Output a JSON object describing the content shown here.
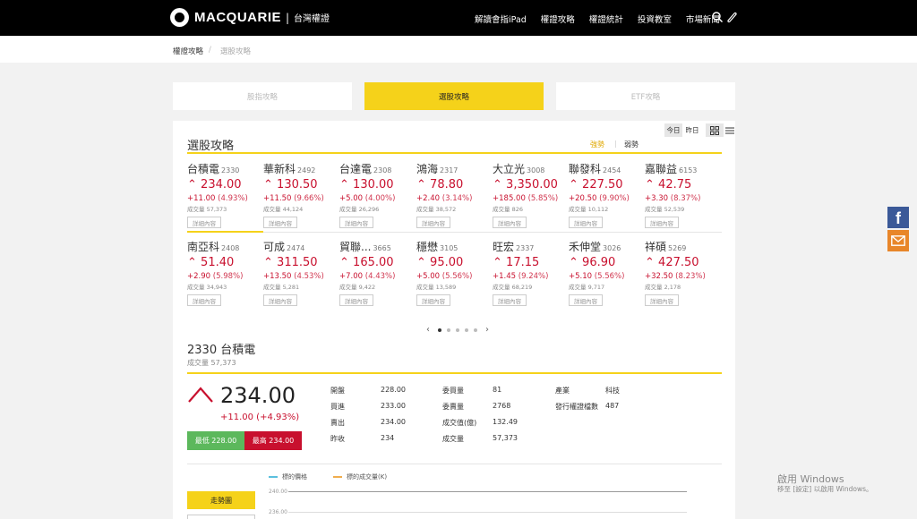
{
  "brand": {
    "name": "MACQUARIE",
    "sub": "台灣權證"
  },
  "nav": [
    "解讀會指iPad",
    "權證攻略",
    "權證統計",
    "投資教室",
    "市場新聞"
  ],
  "breadcrumb": {
    "root": "權證攻略",
    "sep": "/",
    "current": "選股攻略"
  },
  "tabs": [
    "股指攻略",
    "選股攻略",
    "ETF攻略"
  ],
  "view": {
    "today": "今日",
    "yesterday": "昨日"
  },
  "section": {
    "title": "選股攻略",
    "strong": "強勢",
    "weak": "弱勢"
  },
  "stock_detail_label": "詳細內容",
  "stocks": [
    {
      "name": "台積電",
      "code": "2330",
      "price": "234.00",
      "chg": "+11.00",
      "pct": "(4.93%)",
      "vol": "成交量 57,373"
    },
    {
      "name": "華新科",
      "code": "2492",
      "price": "130.50",
      "chg": "+11.50",
      "pct": "(9.66%)",
      "vol": "成交量 44,124"
    },
    {
      "name": "台達電",
      "code": "2308",
      "price": "130.00",
      "chg": "+5.00",
      "pct": "(4.00%)",
      "vol": "成交量 26,296"
    },
    {
      "name": "鴻海",
      "code": "2317",
      "price": "78.80",
      "chg": "+2.40",
      "pct": "(3.14%)",
      "vol": "成交量 38,572"
    },
    {
      "name": "大立光",
      "code": "3008",
      "price": "3,350.00",
      "chg": "+185.00",
      "pct": "(5.85%)",
      "vol": "成交量 826"
    },
    {
      "name": "聯發科",
      "code": "2454",
      "price": "227.50",
      "chg": "+20.50",
      "pct": "(9.90%)",
      "vol": "成交量 10,112"
    },
    {
      "name": "嘉聯益",
      "code": "6153",
      "price": "42.75",
      "chg": "+3.30",
      "pct": "(8.37%)",
      "vol": "成交量 52,539"
    },
    {
      "name": "南亞科",
      "code": "2408",
      "price": "51.40",
      "chg": "+2.90",
      "pct": "(5.98%)",
      "vol": "成交量 34,943"
    },
    {
      "name": "可成",
      "code": "2474",
      "price": "311.50",
      "chg": "+13.50",
      "pct": "(4.53%)",
      "vol": "成交量 5,281"
    },
    {
      "name": "貿聯...",
      "code": "3665",
      "price": "165.00",
      "chg": "+7.00",
      "pct": "(4.43%)",
      "vol": "成交量 9,422"
    },
    {
      "name": "穩懋",
      "code": "3105",
      "price": "95.00",
      "chg": "+5.00",
      "pct": "(5.56%)",
      "vol": "成交量 13,589"
    },
    {
      "name": "旺宏",
      "code": "2337",
      "price": "17.15",
      "chg": "+1.45",
      "pct": "(9.24%)",
      "vol": "成交量 68,219"
    },
    {
      "name": "禾伸堂",
      "code": "3026",
      "price": "96.90",
      "chg": "+5.10",
      "pct": "(5.56%)",
      "vol": "成交量 9,717"
    },
    {
      "name": "祥碩",
      "code": "5269",
      "price": "427.50",
      "chg": "+32.50",
      "pct": "(8.23%)",
      "vol": "成交量 2,178"
    }
  ],
  "pager": {
    "pages": 5,
    "current": 1
  },
  "detail": {
    "title": "2330 台積電",
    "volume": "成交量 57,373",
    "price": "234.00",
    "change": "+11.00 (+4.93%)",
    "low": "最低 228.00",
    "high": "最高 234.00",
    "col1": [
      {
        "k": "開盤",
        "v": "228.00"
      },
      {
        "k": "買進",
        "v": "233.00"
      },
      {
        "k": "賣出",
        "v": "234.00"
      },
      {
        "k": "昨收",
        "v": "234"
      }
    ],
    "col2": [
      {
        "k": "委買量",
        "v": "81"
      },
      {
        "k": "委賣量",
        "v": "2768"
      },
      {
        "k": "成交值(億)",
        "v": "132.49"
      },
      {
        "k": "成交量",
        "v": "57,373"
      }
    ],
    "col3": [
      {
        "k": "產業",
        "v": "科技"
      },
      {
        "k": "發行權證檔數",
        "v": "487"
      }
    ]
  },
  "chart": {
    "legend_price": "標的價格",
    "legend_volume": "標的成交量(K)",
    "y_ticks": [
      "240.00",
      "236.00"
    ],
    "colors": {
      "price": "#5bc0de",
      "volume": "#f0ad4e"
    },
    "button": "走勢圖"
  },
  "watermark": {
    "line1": "啟用 Windows",
    "line2": "移至 [設定] 以啟用 Windows。"
  },
  "colors": {
    "accent": "#f5d21a",
    "up": "#c8102e",
    "low": "#5cb85c"
  }
}
